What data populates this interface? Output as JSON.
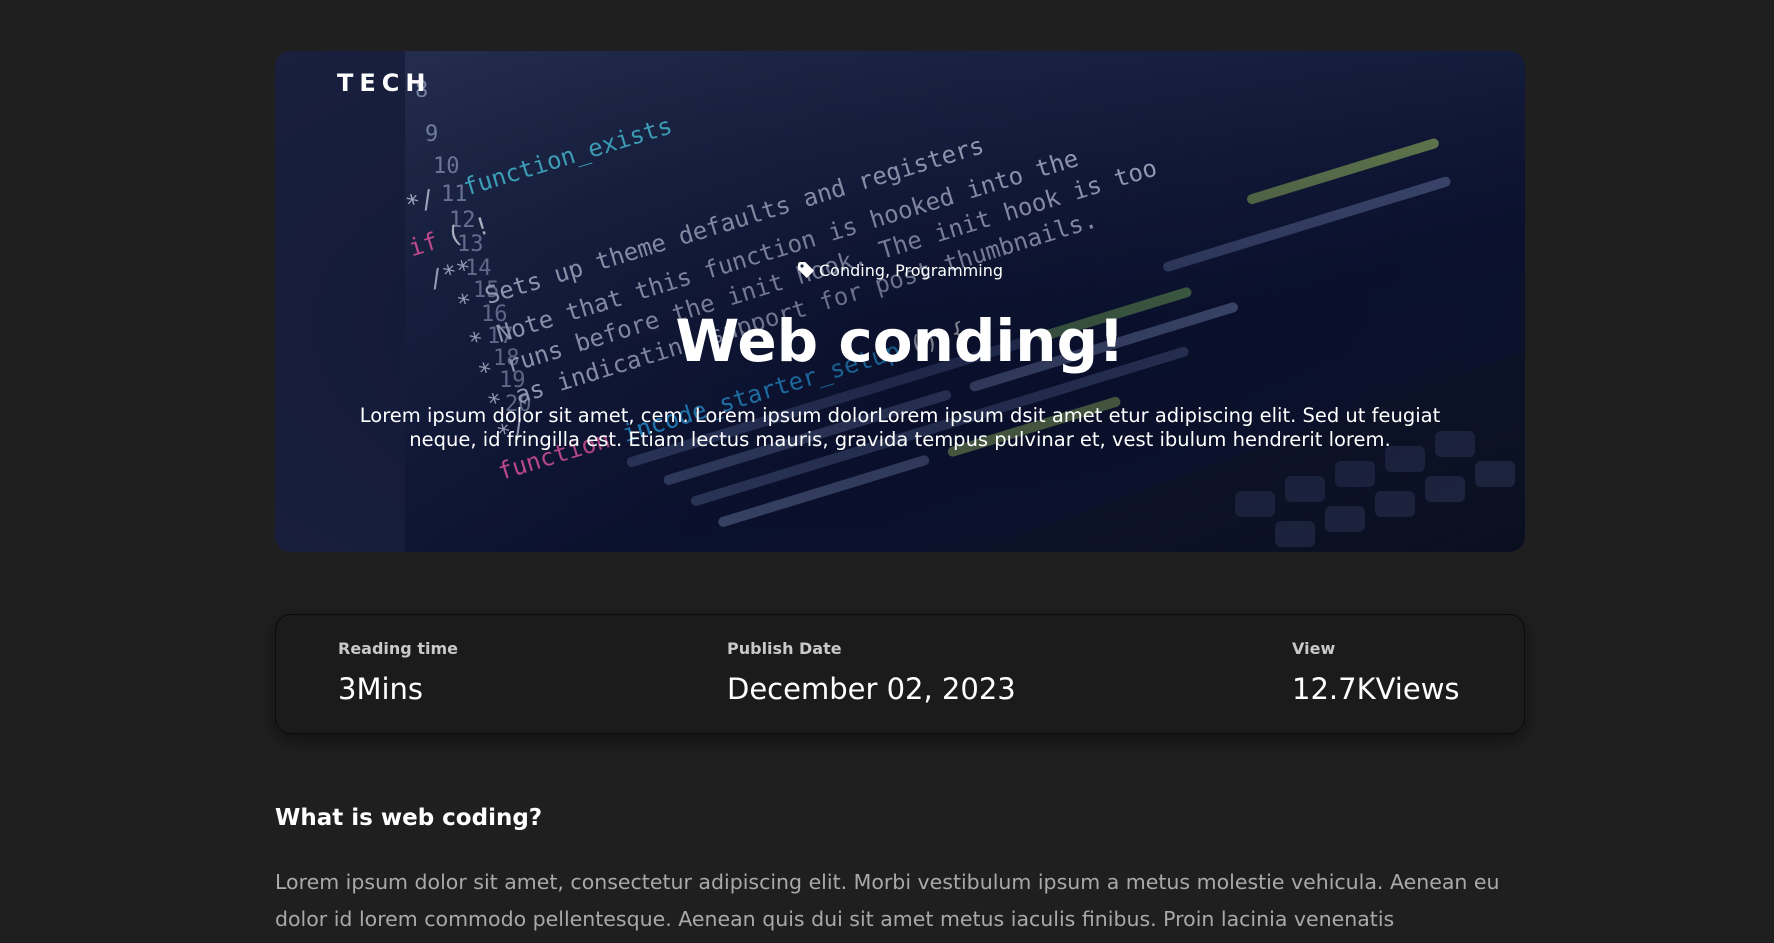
{
  "hero": {
    "brand": "TECH",
    "tags": "Conding, Programming",
    "title": "Web conding!",
    "description": "Lorem ipsum dolor sit amet, cem. Lorem ipsum dolorLorem ipsum dsit amet etur adipiscing elit. Sed ut feugiat neque, id fringilla est. Etiam lectus mauris, gravida tempus pulvinar et, vest ibulum hendrerit lorem.",
    "image_icon": "code-screen-image",
    "tag_icon": "tag-icon"
  },
  "stats": [
    {
      "label": "Reading time",
      "value": "3Mins"
    },
    {
      "label": "Publish Date",
      "value": "December 02, 2023"
    },
    {
      "label": "View",
      "value": "12.7KViews"
    }
  ],
  "article": {
    "heading": "What is web coding?",
    "body": "Lorem ipsum dolor sit amet, consectetur adipiscing elit. Morbi vestibulum ipsum a metus molestie vehicula. Aenean eu dolor id lorem commodo pellentesque. Aenean quis dui sit amet metus iaculis finibus. Proin lacinia venenatis"
  },
  "colors": {
    "page_background": "#1f1f1f",
    "card_background": "#1b1b1b",
    "body_text": "#a9a9a9",
    "heading_text": "#ffffff"
  }
}
